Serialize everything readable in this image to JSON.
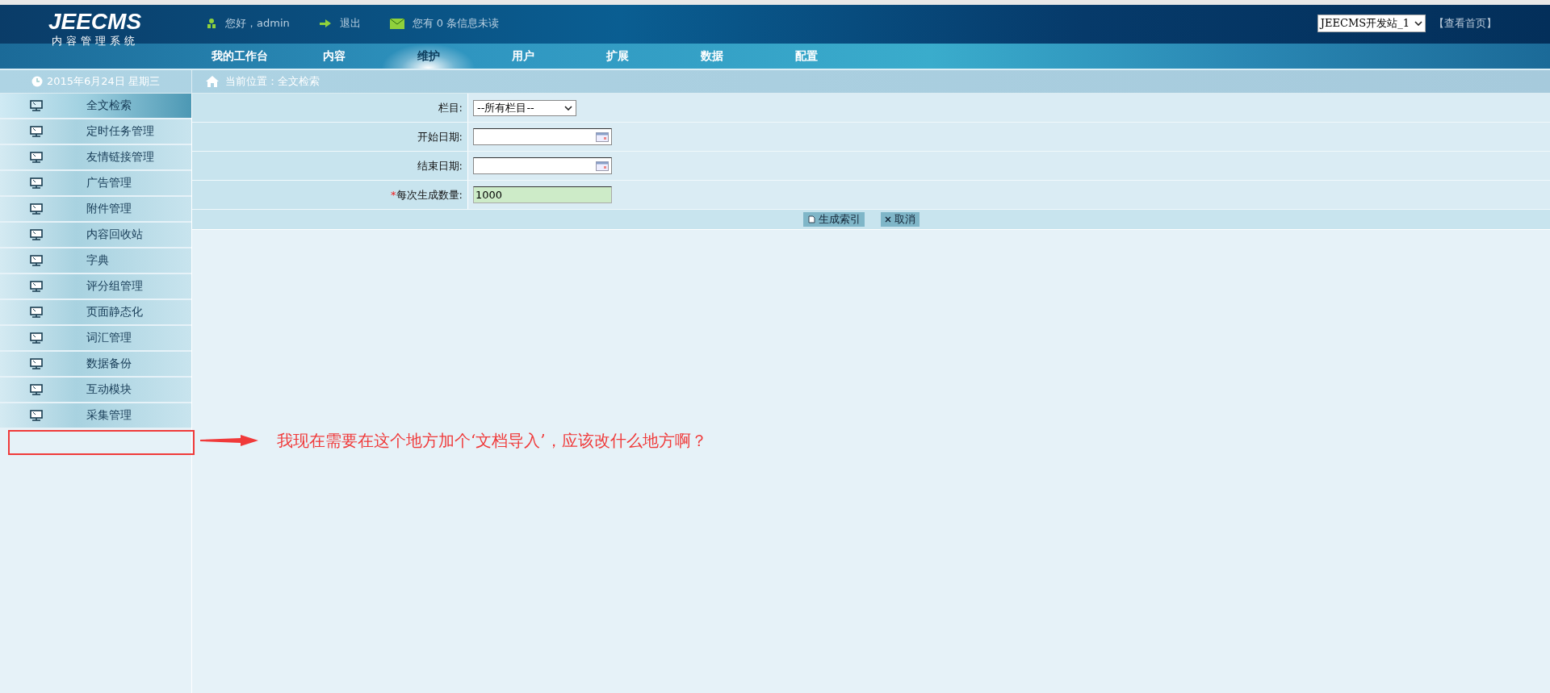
{
  "header": {
    "logo": {
      "title": "JEECMS",
      "subtitle": "内容管理系统"
    },
    "greeting": "您好，admin",
    "logout": "退出",
    "messages": "您有 0 条信息未读",
    "site_select": {
      "value": "JEECMS开发站_1"
    },
    "view_home": "【查看首页】"
  },
  "nav": [
    {
      "label": "我的工作台",
      "selected": false
    },
    {
      "label": "内容",
      "selected": false
    },
    {
      "label": "维护",
      "selected": true
    },
    {
      "label": "用户",
      "selected": false
    },
    {
      "label": "扩展",
      "selected": false
    },
    {
      "label": "数据",
      "selected": false
    },
    {
      "label": "配置",
      "selected": false
    }
  ],
  "date": "2015年6月24日 星期三",
  "breadcrumb": "当前位置：全文检索",
  "sidebar": {
    "items": [
      {
        "label": "全文检索",
        "selected": true
      },
      {
        "label": "定时任务管理",
        "selected": false
      },
      {
        "label": "友情链接管理",
        "selected": false
      },
      {
        "label": "广告管理",
        "selected": false
      },
      {
        "label": "附件管理",
        "selected": false
      },
      {
        "label": "内容回收站",
        "selected": false
      },
      {
        "label": "字典",
        "selected": false
      },
      {
        "label": "评分组管理",
        "selected": false
      },
      {
        "label": "页面静态化",
        "selected": false
      },
      {
        "label": "词汇管理",
        "selected": false
      },
      {
        "label": "数据备份",
        "selected": false
      },
      {
        "label": "互动模块",
        "selected": false
      },
      {
        "label": "采集管理",
        "selected": false
      }
    ]
  },
  "form": {
    "fields": [
      {
        "kind": "select",
        "label": "栏目:",
        "value": "--所有栏目--"
      },
      {
        "kind": "date",
        "label": "开始日期:"
      },
      {
        "kind": "date",
        "label": "结束日期:"
      },
      {
        "kind": "text",
        "label": "每次生成数量:",
        "value": "1000",
        "required_mark": "*"
      }
    ],
    "buttons": [
      {
        "kind": "index",
        "label": "生成索引"
      },
      {
        "kind": "cancel",
        "label": "取消"
      }
    ]
  },
  "annotation": {
    "text": "我现在需要在这个地方加个‘文档导入’，应该改什么地方啊？"
  }
}
